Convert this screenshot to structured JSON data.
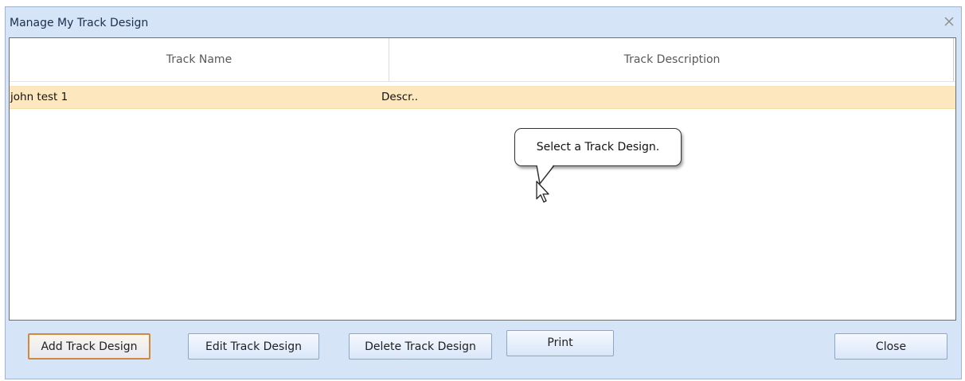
{
  "window": {
    "title": "Manage My Track Design"
  },
  "grid": {
    "columns": [
      "Track Name",
      "Track Description"
    ],
    "rows": [
      {
        "name": "john test 1",
        "description": "Descr.."
      }
    ]
  },
  "tooltip": {
    "text": "Select a Track Design."
  },
  "buttons": {
    "add": "Add Track Design",
    "edit": "Edit Track Design",
    "delete": "Delete Track Design",
    "print": "Print",
    "close": "Close"
  },
  "icons": {
    "window_close": "close-icon",
    "pointer": "mouse-pointer-icon"
  },
  "colors": {
    "window_bg": "#d5e4f7",
    "selected_row": "#fde7bf",
    "default_button_border": "#d18a3b"
  }
}
